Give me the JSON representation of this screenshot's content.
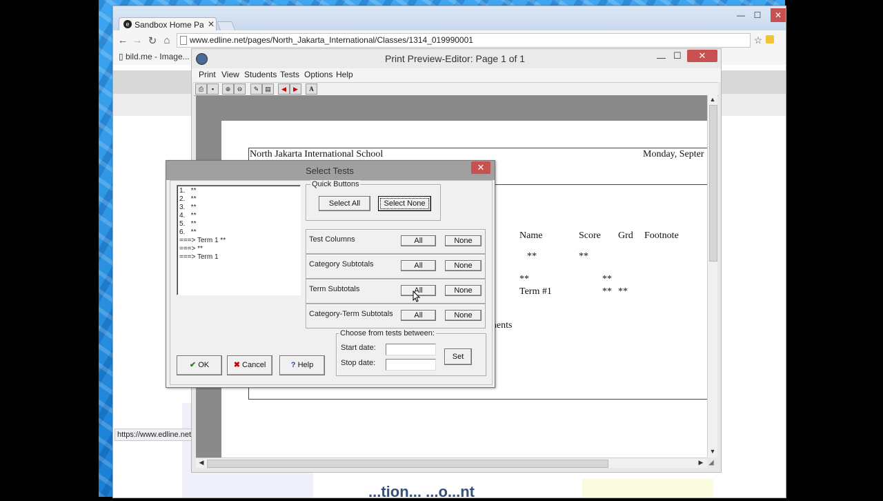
{
  "browser": {
    "tab_title": "Sandbox Home Page",
    "url": "www.edline.net/pages/North_Jakarta_International/Classes/1314_019990001",
    "bookmark": "bild.me - Image...",
    "status_url": "https://www.edline.net/InterstitialLogin.page#",
    "bottom_heading": "...tion... ...o...nt"
  },
  "print_preview": {
    "title": "Print Preview-Editor:  Page 1 of 1",
    "menu": [
      "Print",
      "View",
      "Students",
      "Tests",
      "Options",
      "Help"
    ],
    "paper": {
      "school": "North Jakarta International School",
      "date": "Monday, Septer",
      "col_name": "Name",
      "col_score": "Score",
      "col_grd": "Grd",
      "col_footnote": "Footnote",
      "r1_name": "**",
      "r1_score": "**",
      "r2_name": "**",
      "r2_score": "**",
      "r3_name": "Term #1",
      "r3_score": "**",
      "r3_grd": "**",
      "fragment": "ments"
    }
  },
  "dialog": {
    "title": "Select Tests",
    "list_items": [
      "1.   **",
      "2.   **",
      "3.   **",
      "4.   **",
      "5.   **",
      "6.   **",
      "===> Term 1 **",
      "===> **",
      "===> Term 1"
    ],
    "quick_buttons_label": "Quick Buttons",
    "select_all": "Select All",
    "select_none": "Select None",
    "rows": [
      {
        "label": "Test Columns",
        "all": "All",
        "none": "None"
      },
      {
        "label": "Category Subtotals",
        "all": "All",
        "none": "None"
      },
      {
        "label": "Term Subtotals",
        "all": "All",
        "none": "None"
      },
      {
        "label": "Category-Term Subtotals",
        "all": "All",
        "none": "None"
      }
    ],
    "date_group_label": "Choose from tests between:",
    "start_label": "Start date:",
    "stop_label": "Stop date:",
    "start_value": "",
    "stop_value": "",
    "set": "Set",
    "ok": "OK",
    "cancel": "Cancel",
    "help": "Help"
  }
}
